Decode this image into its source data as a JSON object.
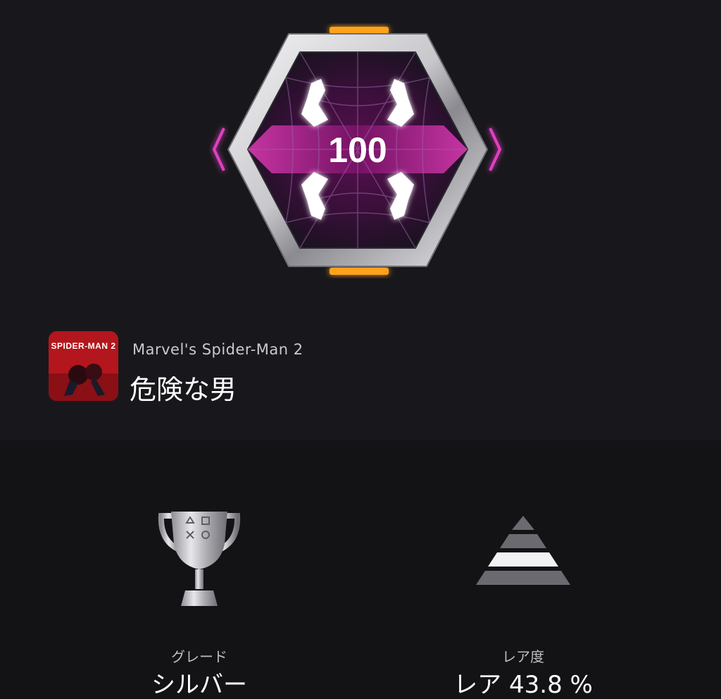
{
  "trophy": {
    "badge_number": "100",
    "badge_icon": "spider-emblem-icon",
    "colors": {
      "badge_inner": "#7a1a6a",
      "badge_glow": "#e040c0",
      "frame_silver": "#d8d8dc",
      "accent_orange": "#ff9a1a"
    }
  },
  "game": {
    "icon_title": "SPIDER-MAN 2",
    "name": "Marvel's Spider-Man 2",
    "icon_color": "#b3161c"
  },
  "trophy_name": "危険な男",
  "stats": {
    "grade": {
      "icon": "silver-trophy-icon",
      "label": "グレード",
      "value": "シルバー"
    },
    "rarity": {
      "icon": "rarity-pyramid-icon",
      "label": "レア度",
      "value": "レア 43.8 %",
      "tier_highlighted": 3,
      "tier_count": 4
    }
  }
}
